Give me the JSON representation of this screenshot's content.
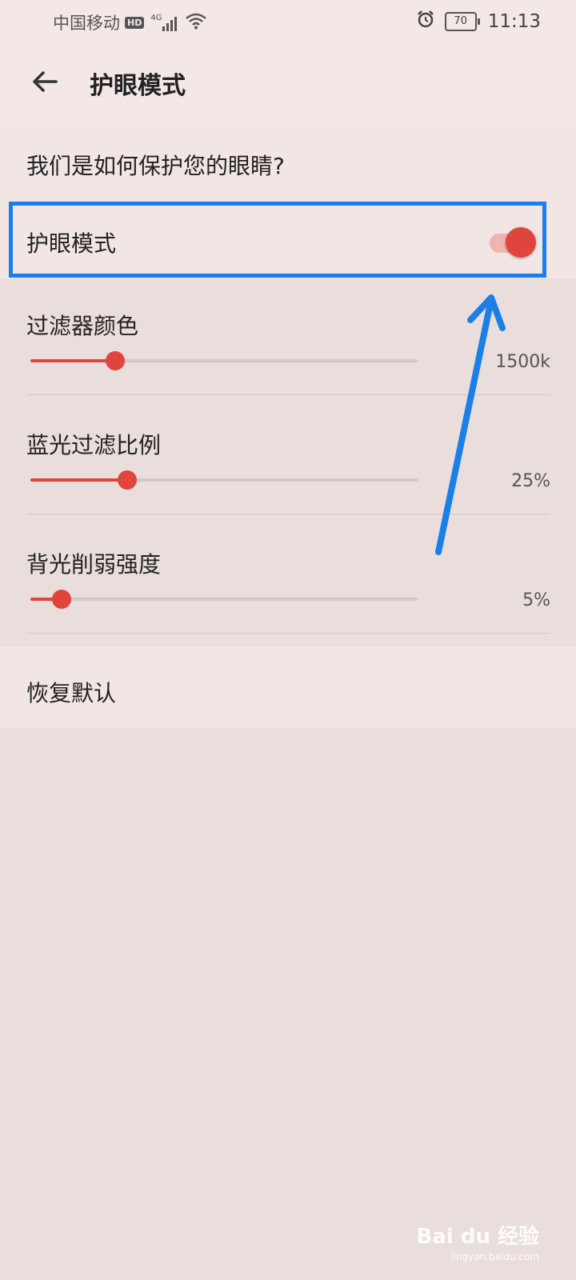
{
  "status_bar": {
    "carrier": "中国移动",
    "hd_badge": "HD",
    "network_type": "4G",
    "battery_level": "70",
    "time": "11:13"
  },
  "app_bar": {
    "title": "护眼模式",
    "back_icon": "arrow-left-icon"
  },
  "intro": {
    "link_text": "我们是如何保护您的眼睛?"
  },
  "eye_comfort": {
    "label": "护眼模式",
    "enabled": true
  },
  "settings": [
    {
      "label": "过滤器颜色",
      "value_text": "1500k",
      "fraction": 0.22
    },
    {
      "label": "蓝光过滤比例",
      "value_text": "25%",
      "fraction": 0.25
    },
    {
      "label": "背光削弱强度",
      "value_text": "5%",
      "fraction": 0.08
    }
  ],
  "reset": {
    "label": "恢复默认"
  },
  "watermark": {
    "brand": "Bai du 经验",
    "url": "jingyan.baidu.com"
  },
  "colors": {
    "accent": "#e0453d",
    "highlight_box": "#1a7fe6",
    "background": "#e9dedc"
  }
}
